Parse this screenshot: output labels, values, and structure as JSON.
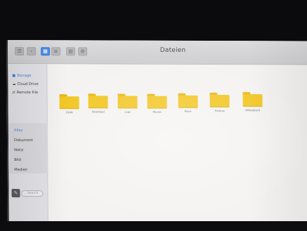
{
  "window": {
    "title": "Dateien"
  },
  "toolbar": {
    "buttons": [
      {
        "name": "sidebar-toggle-button",
        "icon": "sidebar-icon",
        "glyph": "☰",
        "active": false
      },
      {
        "name": "back-button",
        "icon": "chevron-left-icon",
        "glyph": "‹",
        "active": false
      },
      {
        "name": "grid-view-button",
        "icon": "grid-icon",
        "glyph": "▦",
        "active": true
      },
      {
        "name": "list-view-button",
        "icon": "list-icon",
        "glyph": "≡",
        "active": false
      },
      {
        "name": "sort-button",
        "icon": "sort-icon",
        "glyph": "▤",
        "active": false
      },
      {
        "name": "settings-button",
        "icon": "gear-icon",
        "glyph": "⚙",
        "active": false
      }
    ]
  },
  "sidebar": {
    "locations": [
      {
        "label": "Storage",
        "icon": "storage-icon",
        "glyph": "■",
        "selected": true
      },
      {
        "label": "Cloud Drive",
        "icon": "cloud-icon",
        "glyph": "☁",
        "selected": false
      },
      {
        "label": "Remote File",
        "icon": "remote-icon",
        "glyph": "⇄",
        "selected": false
      }
    ],
    "categories": [
      {
        "label": "Alles",
        "selected": true
      },
      {
        "label": "Dokument",
        "selected": false
      },
      {
        "label": "Notiz",
        "selected": false
      },
      {
        "label": "Bild",
        "selected": false
      },
      {
        "label": "Medien",
        "selected": false
      }
    ],
    "search_placeholder": "Search"
  },
  "folders": [
    {
      "label": "DCIM"
    },
    {
      "label": "Download"
    },
    {
      "label": "Logs"
    },
    {
      "label": "Movies"
    },
    {
      "label": "Music"
    },
    {
      "label": "Pictures"
    },
    {
      "label": "Whiteboard"
    }
  ],
  "colors": {
    "accent": "#4d8fe6",
    "folder": "#f2c51e"
  }
}
